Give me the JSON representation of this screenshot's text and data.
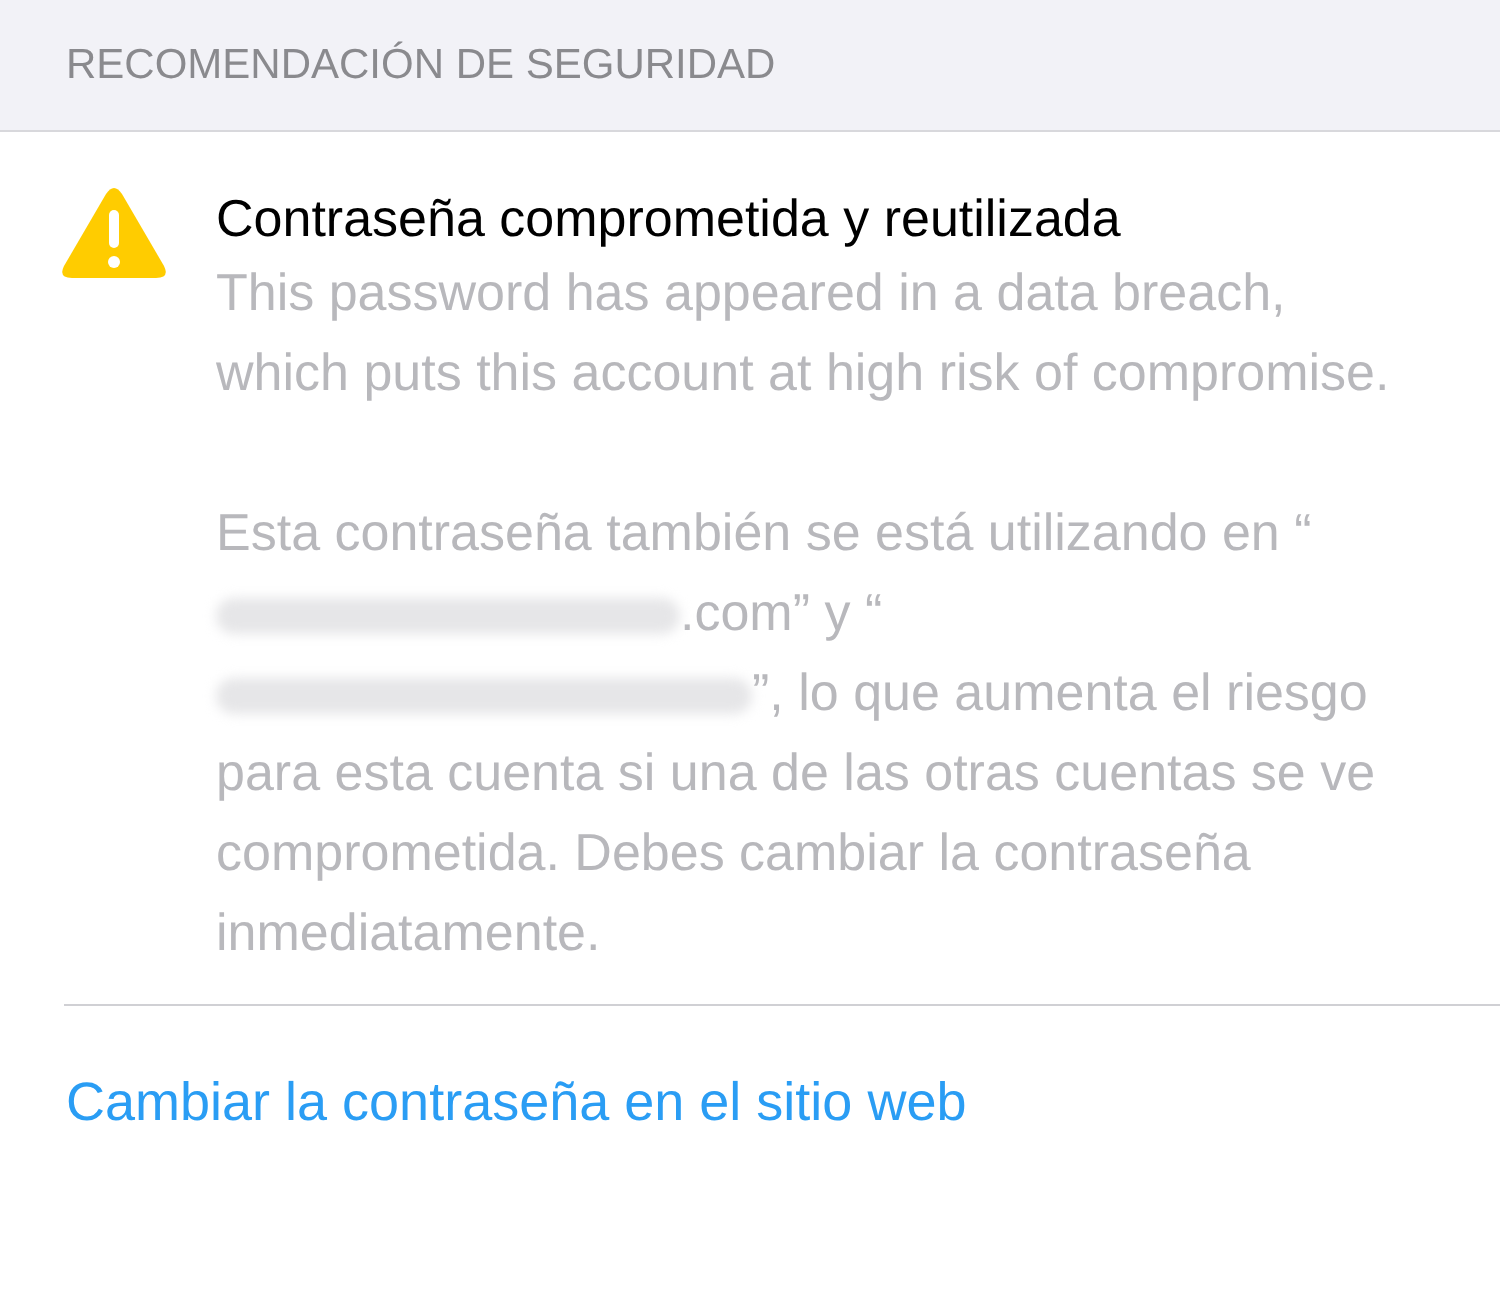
{
  "section_header": "RECOMENDACIÓN DE SEGURIDAD",
  "warning": {
    "title": "Contraseña comprometida y reutilizada",
    "paragraphs": [
      [
        {
          "kind": "text",
          "text": "This password has appeared in a data breach, which puts this account at high risk of compromise."
        }
      ],
      [
        {
          "kind": "text",
          "text": "Esta contraseña también se está utilizando en “"
        },
        {
          "kind": "redacted"
        },
        {
          "kind": "text",
          "text": ".com” y “"
        },
        {
          "kind": "redacted"
        },
        {
          "kind": "text",
          "text": "”, lo que aumenta el riesgo para esta cuenta si una de las otras cuentas se ve comprometida. Debes cambiar la contraseña inmediatamente."
        }
      ]
    ]
  },
  "link": "Cambiar la contraseña en el sitio web"
}
